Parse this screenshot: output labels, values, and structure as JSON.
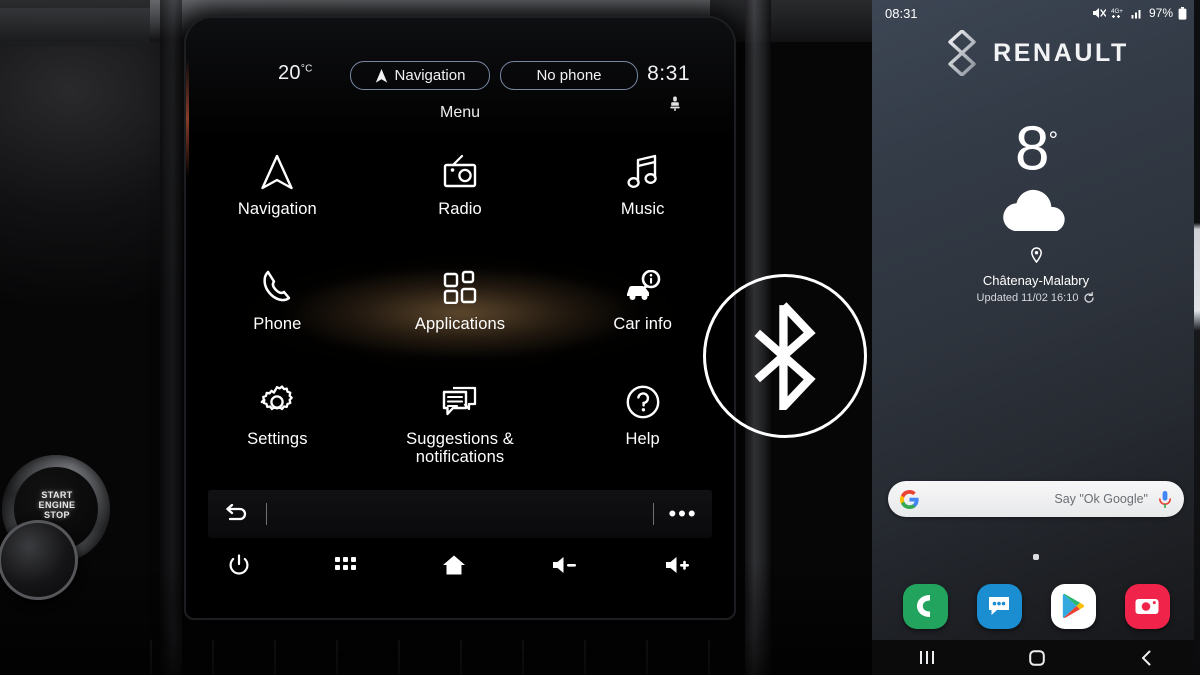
{
  "car_screen": {
    "status": {
      "temperature": "20",
      "temperature_unit": "°C",
      "nav_pill_label": "Navigation",
      "nav_pill_icon": "navigation-arrow-icon",
      "phone_pill_label": "No phone",
      "clock": "8:31",
      "profile_icon": "driver-seat-icon"
    },
    "page_title": "Menu",
    "menu_rows": [
      [
        {
          "label": "Navigation",
          "icon": "navigation-arrow-icon"
        },
        {
          "label": "Radio",
          "icon": "radio-icon"
        },
        {
          "label": "Music",
          "icon": "music-note-icon"
        }
      ],
      [
        {
          "label": "Phone",
          "icon": "phone-handset-icon"
        },
        {
          "label": "Applications",
          "icon": "apps-grid-icon"
        },
        {
          "label": "Car info",
          "icon": "car-info-icon"
        }
      ],
      [
        {
          "label": "Settings",
          "icon": "gear-icon"
        },
        {
          "label": "Suggestions &\nnotifications",
          "icon": "speech-bubbles-icon"
        },
        {
          "label": "Help",
          "icon": "question-mark-icon"
        }
      ]
    ],
    "taskbar": {
      "back_icon": "back-arrow-icon",
      "overflow_icon": "more-dots-icon"
    },
    "hardware_bar": [
      {
        "icon": "power-icon",
        "name": "power-button"
      },
      {
        "icon": "apps-dots-icon",
        "name": "apps-button"
      },
      {
        "icon": "home-icon",
        "name": "home-button"
      },
      {
        "icon": "volume-down-icon",
        "name": "volume-down-button"
      },
      {
        "icon": "volume-up-icon",
        "name": "volume-up-button"
      }
    ],
    "glow_color": "#b28856"
  },
  "overlay": {
    "badge_icon": "bluetooth-icon",
    "badge_color": "#ffffff"
  },
  "car_interior": {
    "start_button_text": "START\nENGINE\nSTOP"
  },
  "phone": {
    "status": {
      "time": "08:31",
      "battery": "97%",
      "icons": [
        "mute-icon",
        "data-4g-plus-icon",
        "signal-bars-icon",
        "battery-icon"
      ]
    },
    "brand": {
      "logo_icon": "renault-diamond-icon",
      "name": "RENAULT"
    },
    "weather": {
      "temperature": "8",
      "degree": "°",
      "condition_icon": "cloud-icon",
      "location_icon": "location-pin-icon",
      "location": "Châtenay-Malabry",
      "updated": "Updated 11/02 16:10",
      "refresh_icon": "refresh-icon"
    },
    "search": {
      "logo_icon": "google-g-icon",
      "placeholder": "Say \"Ok Google\"",
      "mic_icon": "microphone-icon"
    },
    "dock": [
      {
        "name": "phone-app",
        "icon": "phone-icon",
        "color": "#22a35e"
      },
      {
        "name": "messages-app",
        "icon": "messages-icon",
        "color": "#1a8ed1"
      },
      {
        "name": "play-store-app",
        "icon": "play-store-icon",
        "color": "#ffffff"
      },
      {
        "name": "camera-app",
        "icon": "camera-icon",
        "color": "#f0234b"
      }
    ],
    "navbar": [
      {
        "name": "recents-button",
        "icon": "recents-icon"
      },
      {
        "name": "home-button",
        "icon": "home-square-icon"
      },
      {
        "name": "back-button",
        "icon": "back-chevron-icon"
      }
    ]
  }
}
